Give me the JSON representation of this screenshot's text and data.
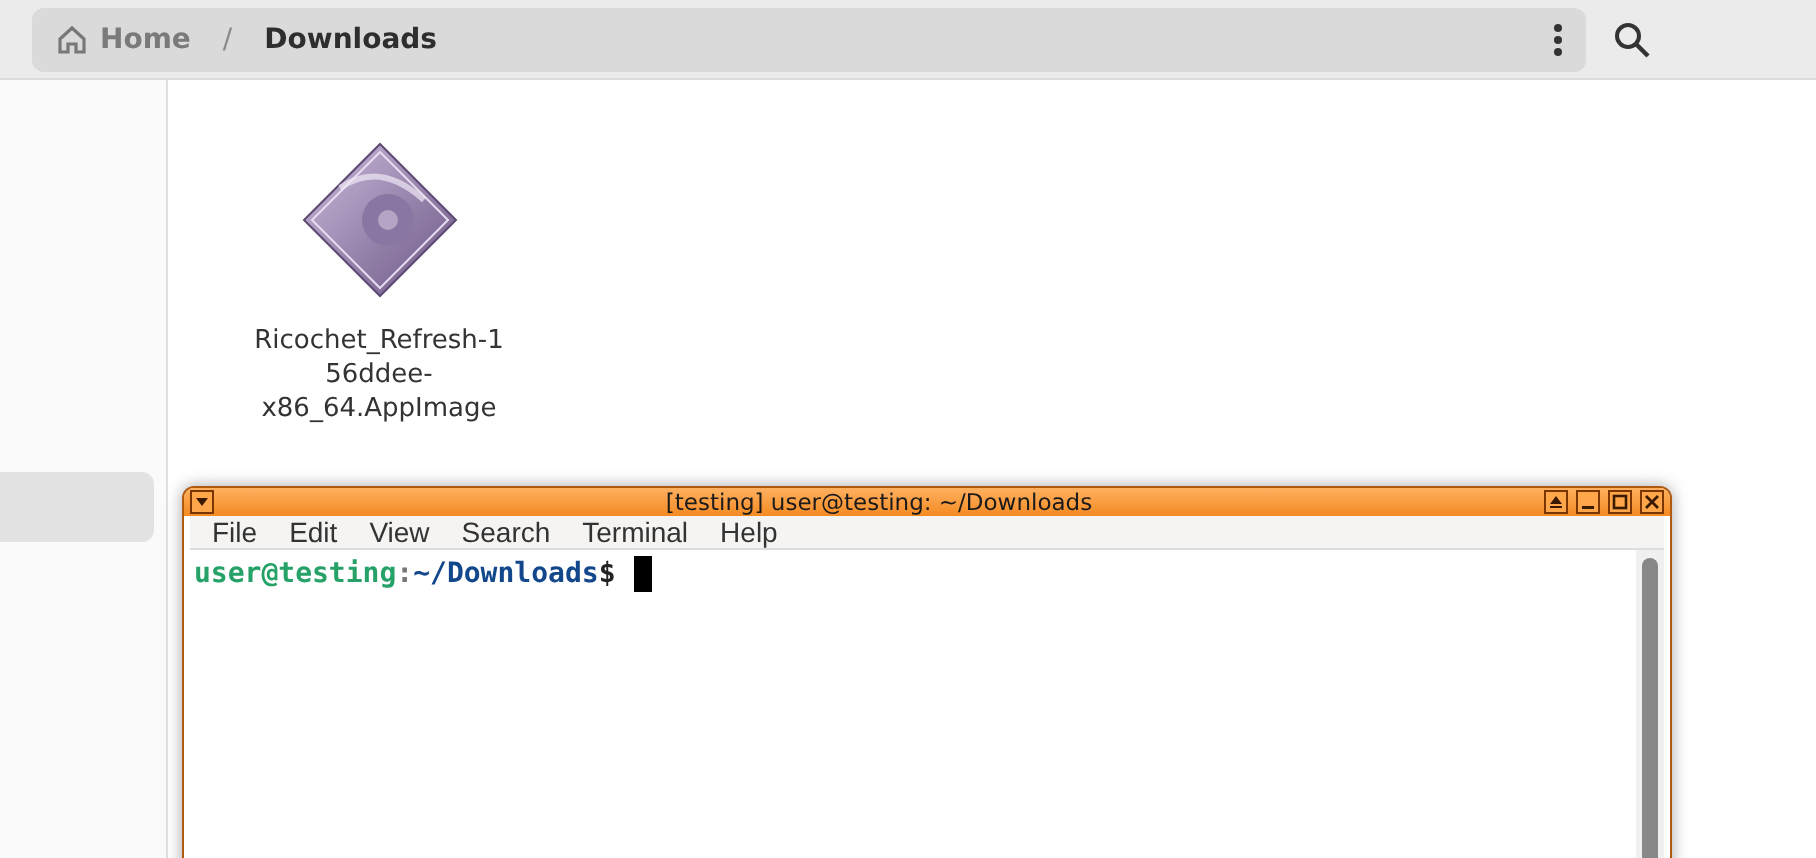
{
  "path_bar": {
    "crumbs": [
      {
        "label": "Home",
        "kind": "home",
        "selected": false
      },
      {
        "label": "Downloads",
        "kind": "folder",
        "selected": true
      }
    ],
    "separator": "/"
  },
  "sidebar": {
    "items": [
      {
        "selected": true
      }
    ]
  },
  "files": [
    {
      "label_lines": [
        "Ricochet_Refresh-1",
        "56ddee-",
        "x86_64.AppImage"
      ]
    }
  ],
  "terminal": {
    "title": "[testing] user@testing: ~/Downloads",
    "menu": [
      "File",
      "Edit",
      "View",
      "Search",
      "Terminal",
      "Help"
    ],
    "prompt": [
      {
        "text": "user@testing",
        "kind": "user"
      },
      {
        "text": ":",
        "kind": "sep"
      },
      {
        "text": "~/Downloads",
        "kind": "path"
      },
      {
        "text": "$",
        "kind": "sign"
      }
    ]
  }
}
